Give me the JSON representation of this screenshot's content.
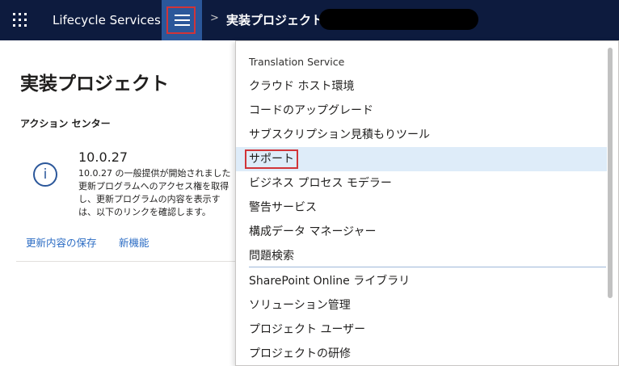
{
  "topbar": {
    "app_title": "Lifecycle Services",
    "breadcrumb_separator": ">",
    "breadcrumb_project": "実装プロジェクト"
  },
  "main": {
    "page_title": "実装プロジェクト",
    "section_title": "アクション センター",
    "notification": {
      "version": "10.0.27",
      "description_lines": [
        "10.0.27 の一般提供が開始されました",
        "更新プログラムへのアクセス権を取得",
        "し、更新プログラムの内容を表示す",
        "は、以下のリンクを確認します。"
      ],
      "links": [
        "更新内容の保存",
        "新機能"
      ]
    }
  },
  "menu": {
    "items": [
      {
        "label": "Translation Service",
        "kind": "header"
      },
      {
        "label": "クラウド ホスト環境"
      },
      {
        "label": "コードのアップグレード"
      },
      {
        "label": "サブスクリプション見積もりツール"
      },
      {
        "label": "サポート",
        "selected": true
      },
      {
        "label": "ビジネス プロセス モデラー"
      },
      {
        "label": "警告サービス"
      },
      {
        "label": "構成データ マネージャー"
      },
      {
        "label": "問題検索"
      },
      {
        "label": "SharePoint Online ライブラリ"
      },
      {
        "label": "ソリューション管理"
      },
      {
        "label": "プロジェクト ユーザー"
      },
      {
        "label": "プロジェクトの研修"
      }
    ]
  },
  "colors": {
    "topbar_bg": "#0d1b3e",
    "hamburger_bg": "#2b579a",
    "highlight_box": "#d13438",
    "selected_bg": "#deecf9",
    "link": "#2b6cc4"
  },
  "icons": [
    "waffle-icon",
    "hamburger-icon",
    "info-icon"
  ]
}
